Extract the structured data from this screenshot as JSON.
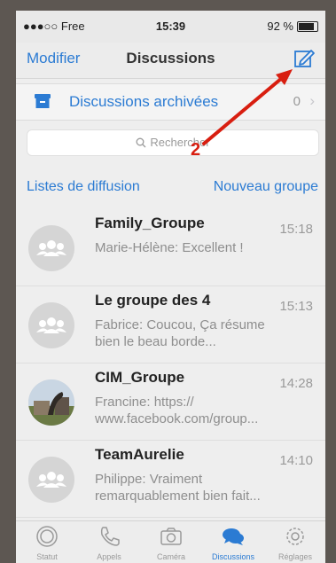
{
  "status_bar": {
    "carrier": "●●●○○ Free",
    "time": "15:39",
    "battery": "92 %",
    "battery_level": 0.92
  },
  "nav": {
    "left_label": "Modifier",
    "title": "Discussions",
    "compose_icon": "compose-icon"
  },
  "archived": {
    "label": "Discussions archivées",
    "count": "0"
  },
  "search": {
    "placeholder": "Rechercher"
  },
  "annotation": {
    "number": "2",
    "color": "#d81e10"
  },
  "links": {
    "broadcast": "Listes de diffusion",
    "new_group": "Nouveau groupe"
  },
  "conversations": [
    {
      "name": "Family_Groupe",
      "time": "15:18",
      "preview": "Marie-Hélène: Excellent !",
      "avatar": "group-icon"
    },
    {
      "name": "Le groupe des 4",
      "time": "15:13",
      "preview": "Fabrice: Coucou, Ça résume bien le beau borde...",
      "avatar": "group-icon"
    },
    {
      "name": "CIM_Groupe",
      "time": "14:28",
      "preview": "Francine: https:// www.facebook.com/group...",
      "avatar": "photo"
    },
    {
      "name": "TeamAurelie",
      "time": "14:10",
      "preview": "Philippe: Vraiment remarquablement bien fait...",
      "avatar": "group-icon"
    }
  ],
  "tabs": [
    {
      "label": "Statut",
      "icon": "status-icon"
    },
    {
      "label": "Appels",
      "icon": "phone-icon"
    },
    {
      "label": "Caméra",
      "icon": "camera-icon"
    },
    {
      "label": "Discussions",
      "icon": "chat-icon",
      "active": true
    },
    {
      "label": "Réglages",
      "icon": "settings-icon"
    }
  ],
  "colors": {
    "accent": "#2b7bd3",
    "annotation": "#d81e10"
  }
}
